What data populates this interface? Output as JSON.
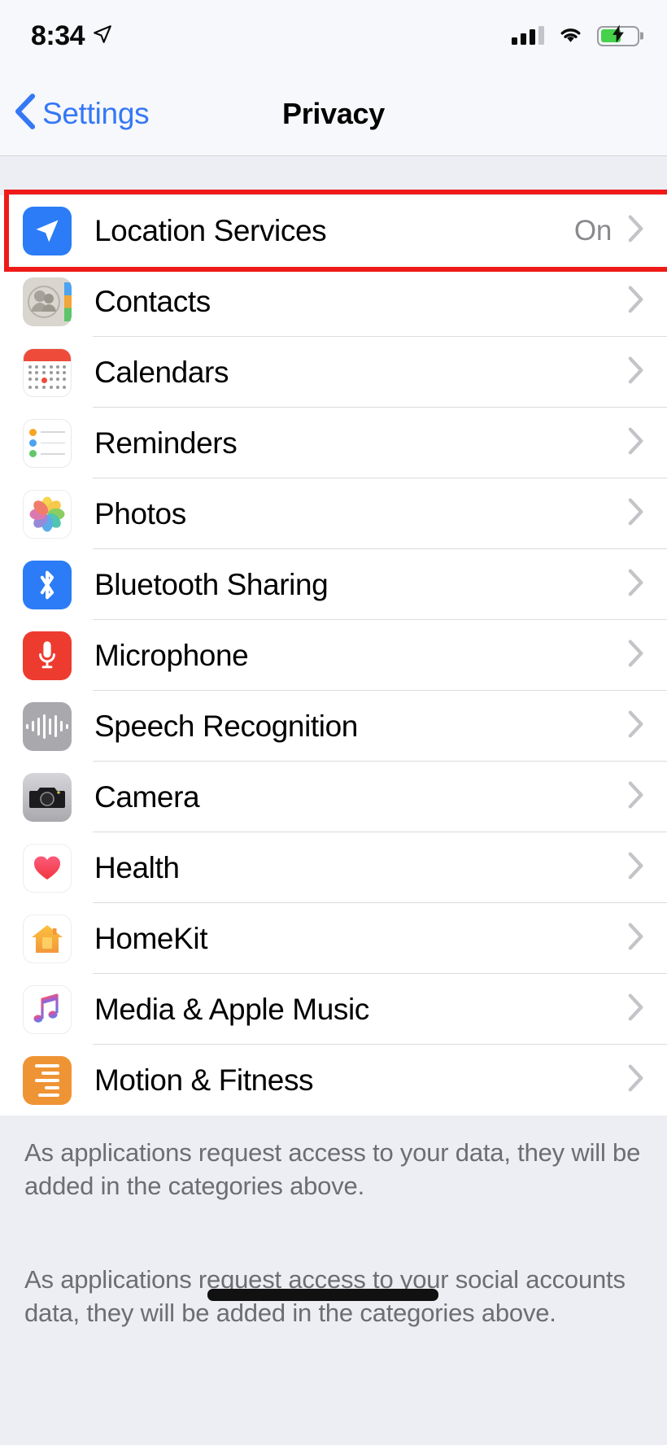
{
  "status_bar": {
    "time": "8:34",
    "location_icon": "location-arrow-icon",
    "cellular": {
      "icon": "cellular-bars-icon",
      "filled_bars": 3,
      "total_bars": 4
    },
    "wifi_icon": "wifi-icon",
    "battery": {
      "icon": "battery-charging-icon",
      "level_percent": 56,
      "charging": true,
      "color": "#45d14a"
    }
  },
  "nav": {
    "back_label": "Settings",
    "back_icon": "chevron-left-icon",
    "title": "Privacy",
    "accent_color": "#3478f6"
  },
  "highlight": {
    "color": "#ee1b18",
    "target": "Location Services"
  },
  "list": {
    "rows": [
      {
        "label": "Location Services",
        "value": "On",
        "icon": "location-arrow-icon",
        "icon_class": "ic-location",
        "highlighted": true
      },
      {
        "label": "Contacts",
        "value": "",
        "icon": "contacts-icon",
        "icon_class": "ic-contacts",
        "highlighted": false
      },
      {
        "label": "Calendars",
        "value": "",
        "icon": "calendar-icon",
        "icon_class": "ic-calendar",
        "highlighted": false
      },
      {
        "label": "Reminders",
        "value": "",
        "icon": "reminders-icon",
        "icon_class": "ic-reminders",
        "highlighted": false
      },
      {
        "label": "Photos",
        "value": "",
        "icon": "photos-icon",
        "icon_class": "ic-photos",
        "highlighted": false
      },
      {
        "label": "Bluetooth Sharing",
        "value": "",
        "icon": "bluetooth-icon",
        "icon_class": "ic-bluetooth",
        "highlighted": false
      },
      {
        "label": "Microphone",
        "value": "",
        "icon": "microphone-icon",
        "icon_class": "ic-mic",
        "highlighted": false
      },
      {
        "label": "Speech Recognition",
        "value": "",
        "icon": "speech-waveform-icon",
        "icon_class": "ic-speech",
        "highlighted": false
      },
      {
        "label": "Camera",
        "value": "",
        "icon": "camera-icon",
        "icon_class": "ic-camera",
        "highlighted": false
      },
      {
        "label": "Health",
        "value": "",
        "icon": "heart-icon",
        "icon_class": "ic-health",
        "highlighted": false
      },
      {
        "label": "HomeKit",
        "value": "",
        "icon": "house-icon",
        "icon_class": "ic-homekit",
        "highlighted": false
      },
      {
        "label": "Media & Apple Music",
        "value": "",
        "icon": "music-note-icon",
        "icon_class": "ic-music",
        "highlighted": false
      },
      {
        "label": "Motion & Fitness",
        "value": "",
        "icon": "motion-lines-icon",
        "icon_class": "ic-motion",
        "highlighted": false
      }
    ],
    "chevron_icon": "chevron-right-icon"
  },
  "footer": {
    "paragraph_1": "As applications request access to your data, they will be added in the categories above.",
    "paragraph_2": "As applications request access to your social accounts data, they will be added in the categories above.",
    "redaction_present": true
  }
}
